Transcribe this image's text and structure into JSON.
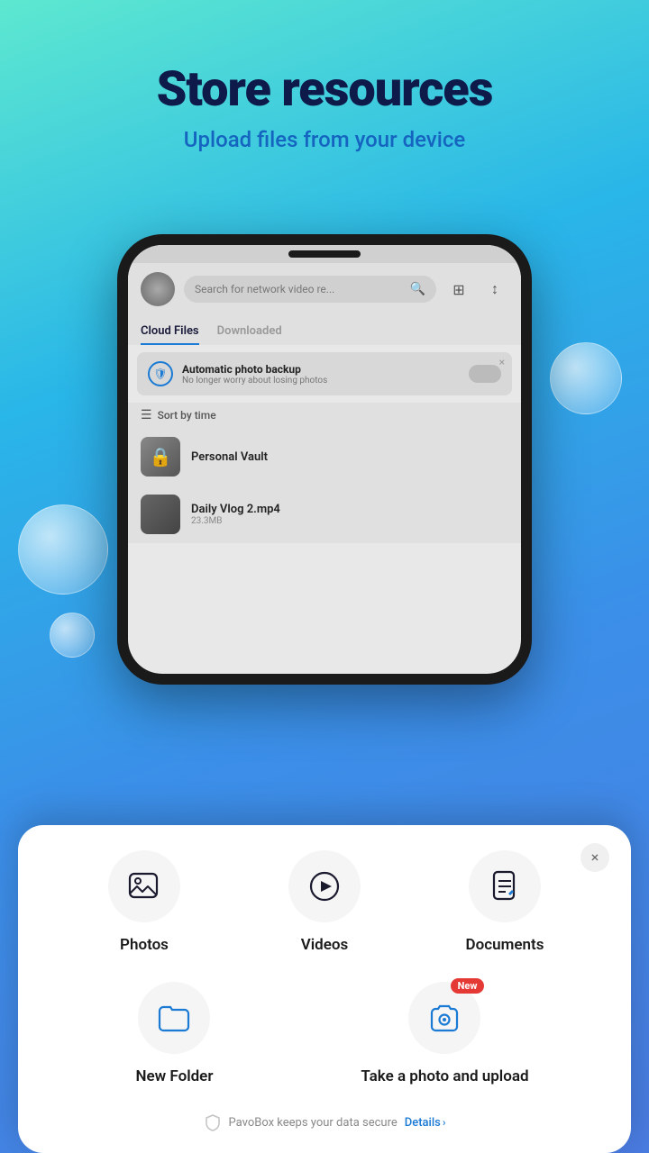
{
  "header": {
    "title": "Store resources",
    "subtitle": "Upload files from your device"
  },
  "phone": {
    "search_placeholder": "Search for network video re...",
    "tabs": [
      {
        "label": "Cloud Files",
        "active": true
      },
      {
        "label": "Downloaded",
        "active": false
      }
    ],
    "backup_banner": {
      "title": "Automatic photo backup",
      "subtitle": "No longer worry about losing photos",
      "close_label": "×"
    },
    "sort_label": "Sort by time",
    "files": [
      {
        "name": "Personal Vault",
        "type": "vault"
      },
      {
        "name": "Daily Vlog 2.mp4",
        "size": "23.3MB",
        "type": "video"
      }
    ]
  },
  "bottom_sheet": {
    "close_label": "×",
    "items_row1": [
      {
        "id": "photos",
        "label": "Photos",
        "icon": "photo"
      },
      {
        "id": "videos",
        "label": "Videos",
        "icon": "video"
      },
      {
        "id": "documents",
        "label": "Documents",
        "icon": "document"
      }
    ],
    "items_row2": [
      {
        "id": "new-folder",
        "label": "New Folder",
        "icon": "folder"
      },
      {
        "id": "take-photo",
        "label": "Take a photo and upload",
        "icon": "camera",
        "badge": "New"
      }
    ],
    "security_text": "PavoBox keeps your data secure",
    "details_label": "Details",
    "details_chevron": "›"
  }
}
